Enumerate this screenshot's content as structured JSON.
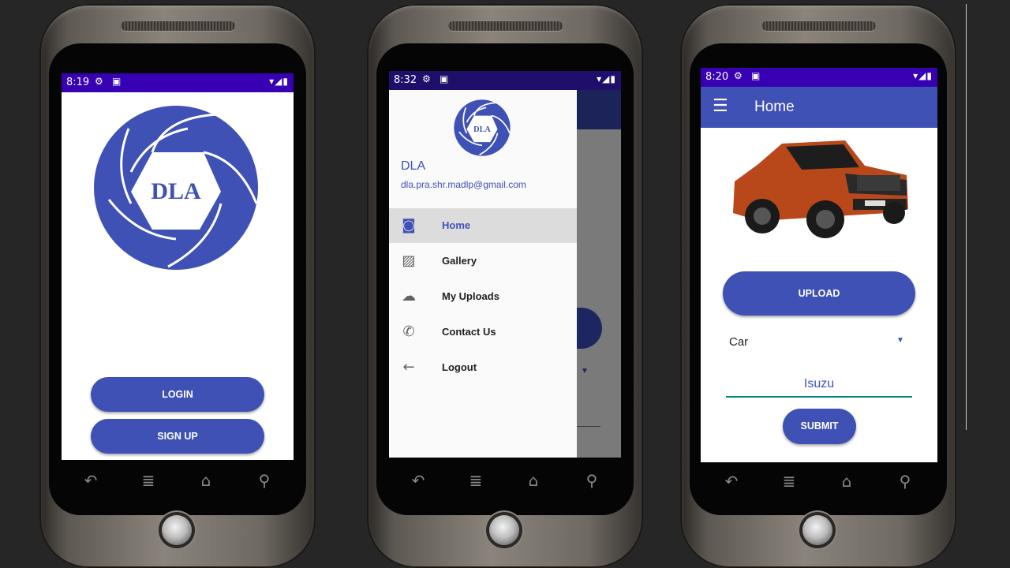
{
  "phone1": {
    "status_time": "8:19",
    "logo_text": "DLA",
    "login_label": "LOGIN",
    "signup_label": "SIGN UP"
  },
  "phone2": {
    "status_time": "8:32",
    "logo_text": "DLA",
    "user_name": "DLA",
    "user_email": "dla.pra.shr.madlp@gmail.com",
    "menu": [
      {
        "label": "Home",
        "icon": "camera-icon",
        "selected": true
      },
      {
        "label": "Gallery",
        "icon": "gallery-icon",
        "selected": false
      },
      {
        "label": "My Uploads",
        "icon": "cloud-upload-icon",
        "selected": false
      },
      {
        "label": "Contact Us",
        "icon": "phone-icon",
        "selected": false
      },
      {
        "label": "Logout",
        "icon": "arrow-back-icon",
        "selected": false
      }
    ]
  },
  "phone3": {
    "status_time": "8:20",
    "toolbar_title": "Home",
    "upload_label": "UPLOAD",
    "category_value": "Car",
    "brand_value": "Isuzu",
    "submit_label": "SUBMIT"
  },
  "colors": {
    "primary": "#3f51b5",
    "status_bar": "#3700b3",
    "accent_teal": "#018786"
  }
}
